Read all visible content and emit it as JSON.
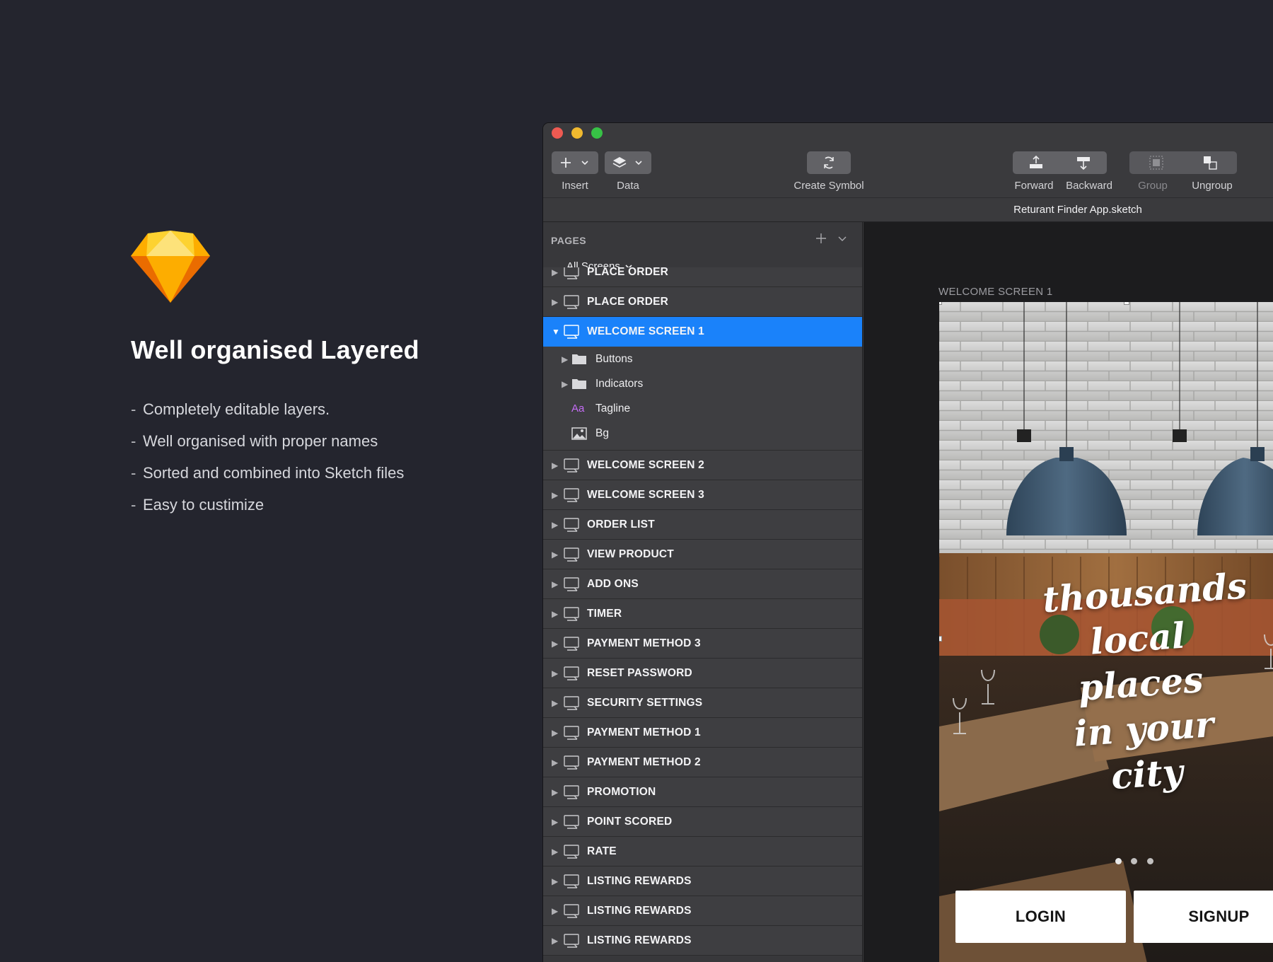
{
  "promo": {
    "title": "Well organised Layered",
    "bullets": [
      {
        "dash": "-",
        "text": "Completely editable layers."
      },
      {
        "dash": "-",
        "text": "Well organised with proper names"
      },
      {
        "dash": "-",
        "text": "Sorted and combined into Sketch files"
      },
      {
        "dash": "-",
        "text": "Easy to custimize"
      }
    ],
    "logo_icon": "sketch-diamond-icon",
    "logo_colors": [
      "#fdb300",
      "#ea6c00",
      "#fdad00",
      "#fdd231"
    ]
  },
  "window": {
    "document_title": "Returant Finder App.sketch",
    "toolbar": {
      "insert_label": "Insert",
      "data_label": "Data",
      "create_symbol_label": "Create Symbol",
      "forward_label": "Forward",
      "backward_label": "Backward",
      "group_label": "Group",
      "ungroup_label": "Ungroup"
    }
  },
  "sidebar": {
    "pages_header": "PAGES",
    "page_selector": "All Screens",
    "artboards_before": [
      {
        "label": "PLACE ORDER"
      },
      {
        "label": "PLACE ORDER"
      }
    ],
    "selected_artboard": {
      "label": "WELCOME SCREEN 1"
    },
    "selected_children": [
      {
        "label": "Buttons",
        "icon": "folder-icon",
        "expandable": true
      },
      {
        "label": "Indicators",
        "icon": "folder-icon",
        "expandable": true
      },
      {
        "label": "Tagline",
        "icon": "text-layer-icon",
        "icon_text": "Aa",
        "expandable": false
      },
      {
        "label": "Bg",
        "icon": "image-layer-icon",
        "expandable": false
      }
    ],
    "artboards_after": [
      {
        "label": "WELCOME SCREEN 2"
      },
      {
        "label": "WELCOME SCREEN 3"
      },
      {
        "label": "ORDER LIST"
      },
      {
        "label": "VIEW PRODUCT"
      },
      {
        "label": "ADD ONS"
      },
      {
        "label": "TIMER"
      },
      {
        "label": "PAYMENT METHOD 3"
      },
      {
        "label": "RESET PASSWORD"
      },
      {
        "label": "SECURITY SETTINGS"
      },
      {
        "label": "PAYMENT METHOD 1"
      },
      {
        "label": "PAYMENT METHOD 2"
      },
      {
        "label": "PROMOTION"
      },
      {
        "label": "POINT SCORED"
      },
      {
        "label": "RATE"
      },
      {
        "label": "LISTING REWARDS"
      },
      {
        "label": "LISTING REWARDS"
      },
      {
        "label": "LISTING REWARDS"
      }
    ],
    "selection_color": "#1a82fa"
  },
  "canvas": {
    "artboard_name": "WELCOME SCREEN 1",
    "tagline_lines": [
      "thousands",
      "local places",
      "in your city"
    ],
    "login_label": "LOGIN",
    "signup_label": "SIGNUP",
    "pager_dots": 3
  }
}
